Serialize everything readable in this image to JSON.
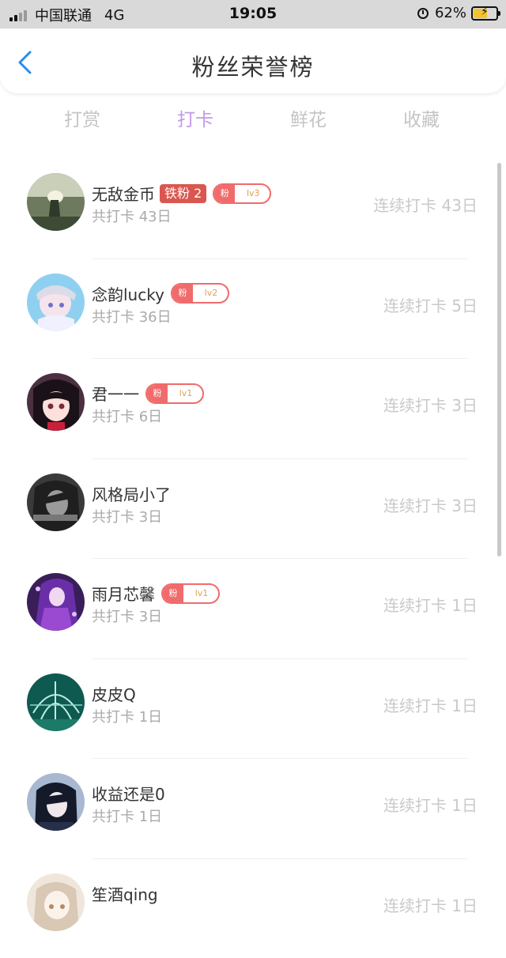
{
  "status_bar": {
    "carrier": "中国联通",
    "network": "4G",
    "time": "19:05",
    "battery": "62%",
    "battery_level": 0.62,
    "signal_bars": 2,
    "signal_max": 4
  },
  "header": {
    "title": "粉丝荣誉榜",
    "back_icon": "chevron-left-icon",
    "accent": "#2a8bea"
  },
  "tabs": [
    {
      "label": "打赏",
      "active": false
    },
    {
      "label": "打卡",
      "active": true
    },
    {
      "label": "鲜花",
      "active": false
    },
    {
      "label": "收藏",
      "active": false
    }
  ],
  "colors": {
    "active_tab": "#c09ae8",
    "badge_red": "#f06b6b",
    "iron_badge": "#d9574f"
  },
  "list": [
    {
      "name": "无敌金币",
      "iron": "铁粉 2",
      "fan": "粉",
      "level": "lv3",
      "total": "共打卡 43日",
      "streak": "连续打卡 43日",
      "avatar_theme": "dark-forest"
    },
    {
      "name": "念韵lucky",
      "iron": "",
      "fan": "粉",
      "level": "lv2",
      "total": "共打卡 36日",
      "streak": "连续打卡 5日",
      "avatar_theme": "anime-blue"
    },
    {
      "name": "君一一",
      "iron": "",
      "fan": "粉",
      "level": "lv1",
      "total": "共打卡 6日",
      "streak": "连续打卡 3日",
      "avatar_theme": "anime-black-hair"
    },
    {
      "name": "风格局小了",
      "iron": "",
      "fan": "",
      "level": "",
      "total": "共打卡 3日",
      "streak": "连续打卡 3日",
      "avatar_theme": "grayscale"
    },
    {
      "name": "雨月芯馨",
      "iron": "",
      "fan": "粉",
      "level": "lv1",
      "total": "共打卡 3日",
      "streak": "连续打卡 1日",
      "avatar_theme": "purple"
    },
    {
      "name": "皮皮Q",
      "iron": "",
      "fan": "",
      "level": "",
      "total": "共打卡 1日",
      "streak": "连续打卡 1日",
      "avatar_theme": "teal-glass"
    },
    {
      "name": "收益还是0",
      "iron": "",
      "fan": "",
      "level": "",
      "total": "共打卡 1日",
      "streak": "连续打卡 1日",
      "avatar_theme": "dark-anime"
    },
    {
      "name": "笙酒qing",
      "iron": "",
      "fan": "",
      "level": "",
      "total": "",
      "streak": "连续打卡 1日",
      "avatar_theme": "pale-anime"
    }
  ]
}
